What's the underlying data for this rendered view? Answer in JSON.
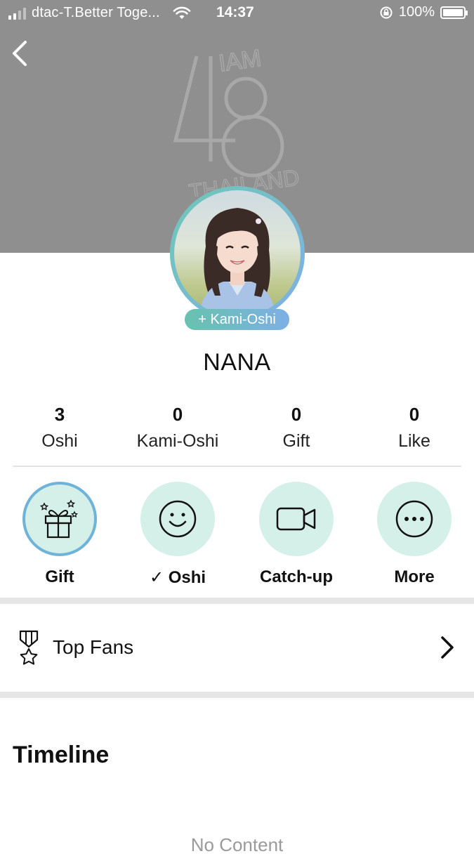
{
  "status_bar": {
    "carrier": "dtac-T.Better Toge...",
    "time": "14:37",
    "battery": "100%"
  },
  "header": {
    "back_icon": "chevron-left-icon",
    "watermark": {
      "number": "48",
      "top_text": "IAM",
      "bottom_text": "THAILAND"
    }
  },
  "profile": {
    "kami_oshi_button": "+ Kami-Oshi",
    "name": "NANA"
  },
  "stats": [
    {
      "value": "3",
      "label": "Oshi"
    },
    {
      "value": "0",
      "label": "Kami-Oshi"
    },
    {
      "value": "0",
      "label": "Gift"
    },
    {
      "value": "0",
      "label": "Like"
    }
  ],
  "actions": [
    {
      "label": "Gift",
      "icon": "gift-icon"
    },
    {
      "label": "✓ Oshi",
      "icon": "smiley-icon"
    },
    {
      "label": "Catch-up",
      "icon": "video-camera-icon"
    },
    {
      "label": "More",
      "icon": "more-dots-icon"
    }
  ],
  "top_fans": {
    "label": "Top Fans",
    "icon": "medal-icon"
  },
  "timeline": {
    "title": "Timeline",
    "empty_text": "No Content"
  },
  "colors": {
    "header_bg": "#8f8f8f",
    "accent_green": "#68c2ae",
    "accent_blue": "#7eafe5",
    "action_circle_bg": "#d4f0e8"
  }
}
